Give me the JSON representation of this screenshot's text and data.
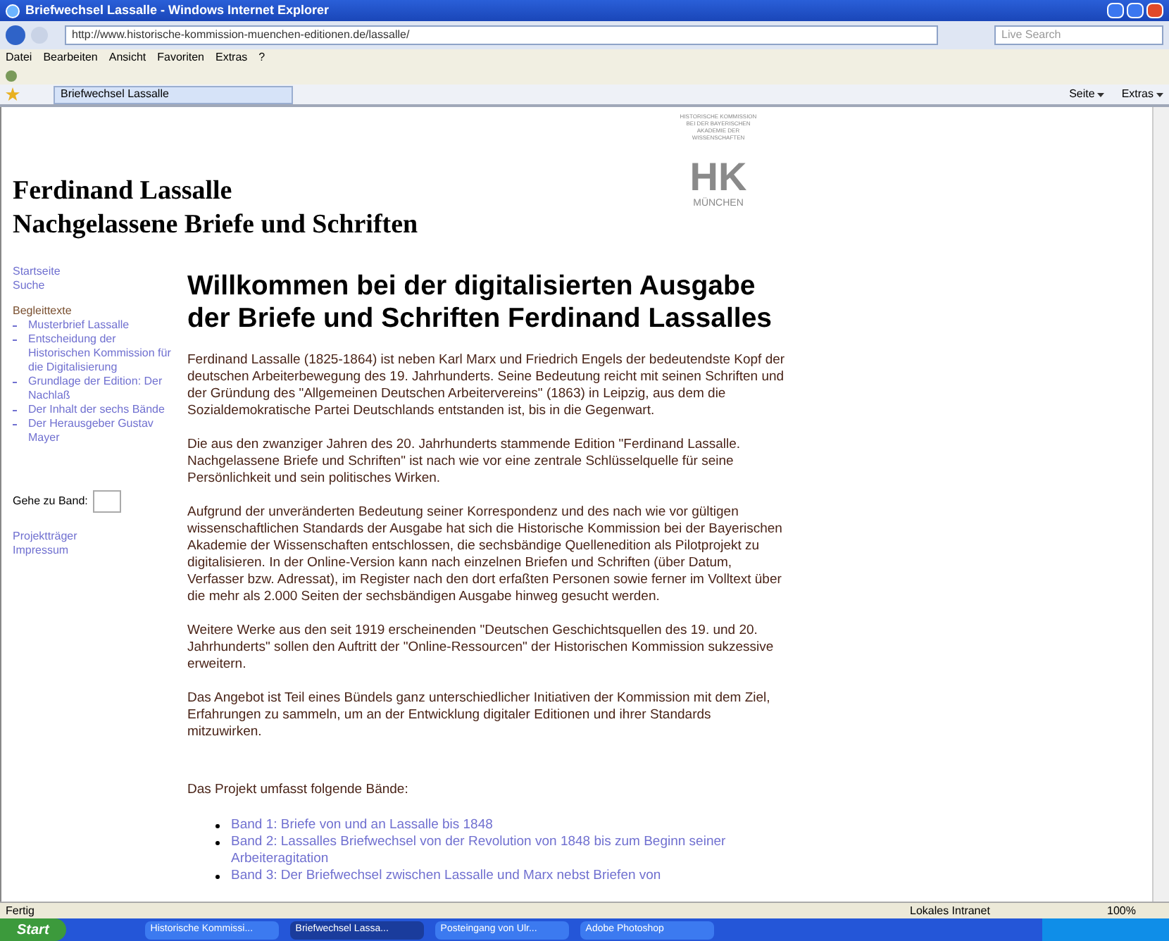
{
  "window": {
    "title": "Briefwechsel Lassalle - Windows Internet Explorer"
  },
  "address_bar": {
    "url": "http://www.historische-kommission-muenchen-editionen.de/lassalle/",
    "search_placeholder": "Live Search"
  },
  "menu": [
    "Datei",
    "Bearbeiten",
    "Ansicht",
    "Favoriten",
    "Extras",
    "?"
  ],
  "tab": {
    "label": "Briefwechsel Lassalle"
  },
  "command_bar": [
    "Seite",
    "Extras"
  ],
  "page": {
    "title_lines": [
      "Ferdinand Lassalle",
      "Nachgelassene Briefe und Schriften"
    ],
    "logo": {
      "caption": "HISTORISCHE KOMMISSION BEI DER BAYERISCHEN AKADEMIE DER WISSENSCHAFTEN",
      "mark": "HK",
      "city": "MÜNCHEN"
    },
    "sidebar": {
      "top_links": [
        "Startseite",
        "Suche"
      ],
      "section": "Begleittexte",
      "items": [
        "Musterbrief Lassalle",
        "Entscheidung der Historischen Kommission für die Digitalisierung",
        "Grundlage der Edition: Der Nachlaß",
        "Der Inhalt der sechs Bände",
        "Der Herausgeber Gustav Mayer"
      ],
      "goto_label": "Gehe zu Band:",
      "bottom_links": [
        "Projektträger",
        "Impressum"
      ]
    },
    "heading": "Willkommen bei der digitalisierten Ausgabe der Briefe und Schriften Ferdinand Lassalles",
    "paragraphs": [
      "Ferdinand Lassalle (1825-1864) ist neben Karl Marx und Friedrich Engels der bedeutendste Kopf der deutschen Arbeiterbewegung des 19. Jahrhunderts. Seine Bedeutung reicht mit seinen Schriften und der Gründung des \"Allgemeinen Deutschen Arbeitervereins\" (1863) in Leipzig, aus dem die Sozialdemokratische Partei Deutschlands entstanden ist, bis in die Gegenwart.",
      "Die aus den zwanziger Jahren des 20. Jahrhunderts stammende Edition \"Ferdinand Lassalle. Nachgelassene Briefe und Schriften\" ist nach wie vor eine zentrale Schlüsselquelle für seine Persönlichkeit und sein politisches Wirken.",
      "Aufgrund der unveränderten Bedeutung seiner Korrespondenz und des nach wie vor gültigen wissenschaftlichen Standards der Ausgabe hat sich die Historische Kommission bei der Bayerischen Akademie der Wissenschaften entschlossen, die sechsbändige Quellenedition als Pilotprojekt zu digitalisieren. In der Online-Version kann nach einzelnen Briefen und Schriften (über Datum, Verfasser bzw. Adressat), im Register nach den dort erfaßten Personen sowie ferner im Volltext über die mehr als 2.000 Seiten der sechsbändigen Ausgabe hinweg gesucht werden.",
      "Weitere Werke aus den seit 1919 erscheinenden \"Deutschen Geschichtsquellen des 19. und 20. Jahrhunderts\" sollen den Auftritt der \"Online-Ressourcen\" der Historischen Kommission sukzessive erweitern.",
      "Das Angebot ist Teil eines Bündels ganz unterschiedlicher Initiativen der Kommission mit dem Ziel, Erfahrungen zu sammeln, um an der Entwicklung digitaler Editionen und ihrer Standards mitzuwirken."
    ],
    "volumes_intro": "Das Projekt umfasst folgende Bände:",
    "volumes": [
      "Band 1: Briefe von und an Lassalle bis 1848",
      "Band 2: Lassalles Briefwechsel von der Revolution von 1848 bis zum Beginn seiner Arbeiteragitation",
      "Band 3: Der Briefwechsel zwischen Lassalle und Marx nebst Briefen von"
    ]
  },
  "status_bar": {
    "text": "Fertig",
    "zone": "Lokales Intranet",
    "zoom": "100%"
  },
  "taskbar": {
    "start": "Start",
    "tasks": [
      {
        "label": "Historische Kommissi...",
        "selected": false
      },
      {
        "label": "Briefwechsel Lassa...",
        "selected": true
      },
      {
        "label": "Posteingang von Ulr...",
        "selected": false
      },
      {
        "label": "Adobe Photoshop",
        "selected": false
      }
    ]
  }
}
